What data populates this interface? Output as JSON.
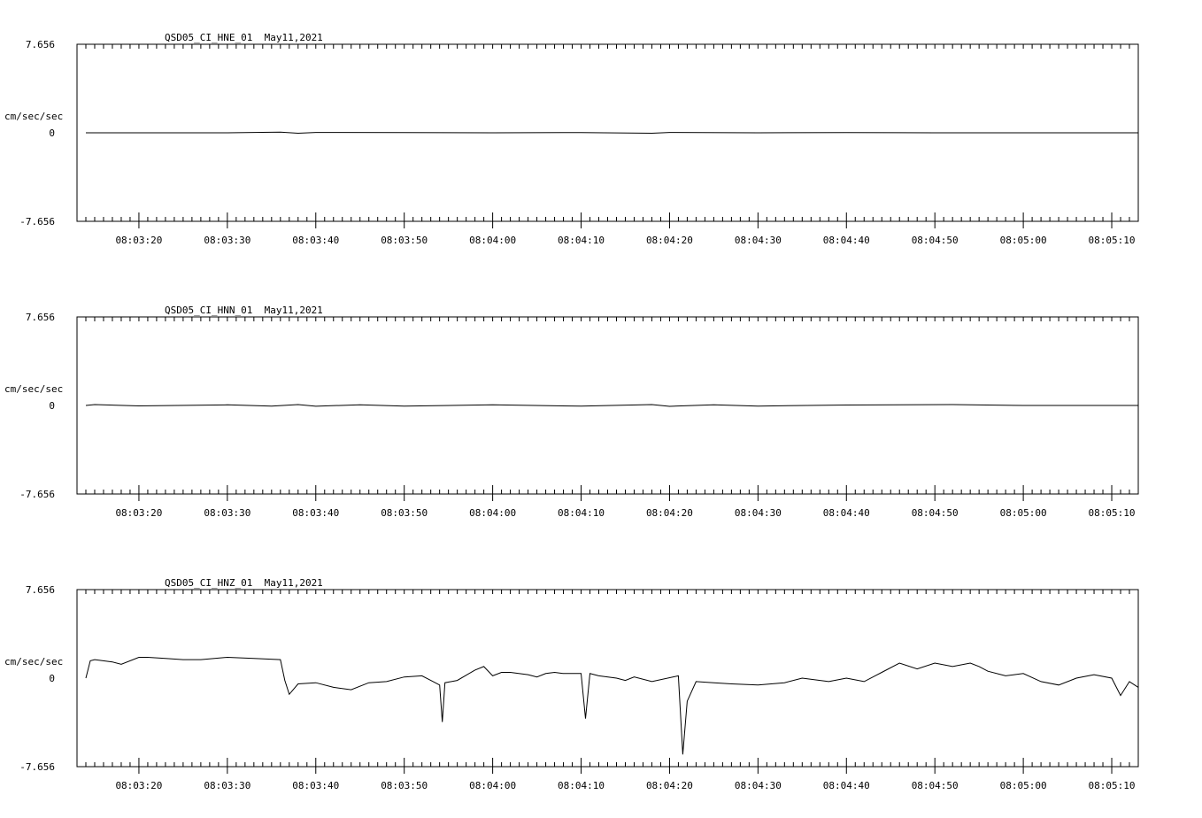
{
  "chart_data": [
    {
      "type": "line",
      "title": "QSD05_CI_HNE_01  May11,2021",
      "ylabel": "cm/sec/sec",
      "y_tick_labels": [
        "7.656",
        "0",
        "-7.656"
      ],
      "ylim": [
        -7.656,
        7.656
      ],
      "x_tick_labels": [
        "08:03:20",
        "08:03:30",
        "08:03:40",
        "08:03:50",
        "08:04:00",
        "08:04:10",
        "08:04:20",
        "08:04:30",
        "08:04:40",
        "08:04:50",
        "08:05:00",
        "08:05:10"
      ],
      "xlim": [
        "08:03:13",
        "08:05:13"
      ],
      "series": [
        {
          "values": [
            [
              "08:03:14",
              0.0
            ],
            [
              "08:03:20",
              0.0
            ],
            [
              "08:03:30",
              0.0
            ],
            [
              "08:03:36",
              0.05
            ],
            [
              "08:03:38",
              -0.04
            ],
            [
              "08:03:40",
              0.03
            ],
            [
              "08:03:50",
              0.02
            ],
            [
              "08:04:00",
              0.0
            ],
            [
              "08:04:10",
              0.02
            ],
            [
              "08:04:18",
              -0.04
            ],
            [
              "08:04:20",
              0.03
            ],
            [
              "08:04:30",
              0.0
            ],
            [
              "08:04:40",
              0.02
            ],
            [
              "08:04:50",
              0.0
            ],
            [
              "08:05:00",
              0.0
            ],
            [
              "08:05:13",
              0.0
            ]
          ]
        }
      ]
    },
    {
      "type": "line",
      "title": "QSD05_CI_HNN_01  May11,2021",
      "ylabel": "cm/sec/sec",
      "y_tick_labels": [
        "7.656",
        "0",
        "-7.656"
      ],
      "ylim": [
        -7.656,
        7.656
      ],
      "x_tick_labels": [
        "08:03:20",
        "08:03:30",
        "08:03:40",
        "08:03:50",
        "08:04:00",
        "08:04:10",
        "08:04:20",
        "08:04:30",
        "08:04:40",
        "08:04:50",
        "08:05:00",
        "08:05:10"
      ],
      "xlim": [
        "08:03:13",
        "08:05:13"
      ],
      "series": [
        {
          "values": [
            [
              "08:03:14",
              0.0
            ],
            [
              "08:03:15",
              0.08
            ],
            [
              "08:03:20",
              -0.04
            ],
            [
              "08:03:30",
              0.05
            ],
            [
              "08:03:35",
              -0.06
            ],
            [
              "08:03:38",
              0.08
            ],
            [
              "08:03:40",
              -0.07
            ],
            [
              "08:03:45",
              0.06
            ],
            [
              "08:03:50",
              -0.05
            ],
            [
              "08:04:00",
              0.05
            ],
            [
              "08:04:10",
              -0.06
            ],
            [
              "08:04:18",
              0.08
            ],
            [
              "08:04:20",
              -0.08
            ],
            [
              "08:04:25",
              0.06
            ],
            [
              "08:04:30",
              -0.05
            ],
            [
              "08:04:40",
              0.04
            ],
            [
              "08:04:52",
              0.08
            ],
            [
              "08:05:00",
              0.0
            ],
            [
              "08:05:13",
              0.0
            ]
          ]
        }
      ]
    },
    {
      "type": "line",
      "title": "QSD05_CI_HNZ_01  May11,2021",
      "ylabel": "cm/sec/sec",
      "y_tick_labels": [
        "7.656",
        "0",
        "-7.656"
      ],
      "ylim": [
        -7.656,
        7.656
      ],
      "x_tick_labels": [
        "08:03:20",
        "08:03:30",
        "08:03:40",
        "08:03:50",
        "08:04:00",
        "08:04:10",
        "08:04:20",
        "08:04:30",
        "08:04:40",
        "08:04:50",
        "08:05:00",
        "08:05:10"
      ],
      "xlim": [
        "08:03:13",
        "08:05:13"
      ],
      "series": [
        {
          "values": [
            [
              "08:03:14",
              0.0
            ],
            [
              "08:03:14.5",
              1.5
            ],
            [
              "08:03:15",
              1.6
            ],
            [
              "08:03:17",
              1.4
            ],
            [
              "08:03:18",
              1.2
            ],
            [
              "08:03:20",
              1.8
            ],
            [
              "08:03:21",
              1.8
            ],
            [
              "08:03:23",
              1.7
            ],
            [
              "08:03:25",
              1.6
            ],
            [
              "08:03:27",
              1.6
            ],
            [
              "08:03:30",
              1.8
            ],
            [
              "08:03:33",
              1.7
            ],
            [
              "08:03:36",
              1.6
            ],
            [
              "08:03:36.5",
              -0.2
            ],
            [
              "08:03:37",
              -1.4
            ],
            [
              "08:03:38",
              -0.5
            ],
            [
              "08:03:40",
              -0.4
            ],
            [
              "08:03:42",
              -0.8
            ],
            [
              "08:03:44",
              -1.0
            ],
            [
              "08:03:46",
              -0.4
            ],
            [
              "08:03:48",
              -0.3
            ],
            [
              "08:03:50",
              0.1
            ],
            [
              "08:03:52",
              0.2
            ],
            [
              "08:03:53",
              -0.2
            ],
            [
              "08:03:54",
              -0.6
            ],
            [
              "08:03:54.3",
              -3.8
            ],
            [
              "08:03:54.6",
              -0.4
            ],
            [
              "08:03:56",
              -0.2
            ],
            [
              "08:03:58",
              0.7
            ],
            [
              "08:03:59",
              1.0
            ],
            [
              "08:04:00",
              0.2
            ],
            [
              "08:04:01",
              0.5
            ],
            [
              "08:04:02",
              0.5
            ],
            [
              "08:04:04",
              0.3
            ],
            [
              "08:04:05",
              0.1
            ],
            [
              "08:04:06",
              0.4
            ],
            [
              "08:04:07",
              0.5
            ],
            [
              "08:04:08",
              0.4
            ],
            [
              "08:04:10",
              0.4
            ],
            [
              "08:04:10.5",
              -3.5
            ],
            [
              "08:04:11",
              0.4
            ],
            [
              "08:04:12",
              0.2
            ],
            [
              "08:04:14",
              0.0
            ],
            [
              "08:04:15",
              -0.2
            ],
            [
              "08:04:16",
              0.1
            ],
            [
              "08:04:18",
              -0.3
            ],
            [
              "08:04:21",
              0.2
            ],
            [
              "08:04:21.5",
              -6.6
            ],
            [
              "08:04:22",
              -2.0
            ],
            [
              "08:04:23",
              -0.3
            ],
            [
              "08:04:25",
              -0.4
            ],
            [
              "08:04:27",
              -0.5
            ],
            [
              "08:04:30",
              -0.6
            ],
            [
              "08:04:33",
              -0.4
            ],
            [
              "08:04:35",
              0.0
            ],
            [
              "08:04:38",
              -0.3
            ],
            [
              "08:04:40",
              0.0
            ],
            [
              "08:04:42",
              -0.3
            ],
            [
              "08:04:44",
              0.5
            ],
            [
              "08:04:46",
              1.3
            ],
            [
              "08:04:48",
              0.8
            ],
            [
              "08:04:50",
              1.3
            ],
            [
              "08:04:52",
              1.0
            ],
            [
              "08:04:54",
              1.3
            ],
            [
              "08:04:55",
              1.0
            ],
            [
              "08:04:56",
              0.6
            ],
            [
              "08:04:58",
              0.2
            ],
            [
              "08:05:00",
              0.4
            ],
            [
              "08:05:02",
              -0.3
            ],
            [
              "08:05:04",
              -0.6
            ],
            [
              "08:05:06",
              0.0
            ],
            [
              "08:05:08",
              0.3
            ],
            [
              "08:05:10",
              0.0
            ],
            [
              "08:05:11",
              -1.5
            ],
            [
              "08:05:12",
              -0.3
            ],
            [
              "08:05:13",
              -0.8
            ]
          ]
        }
      ]
    }
  ]
}
